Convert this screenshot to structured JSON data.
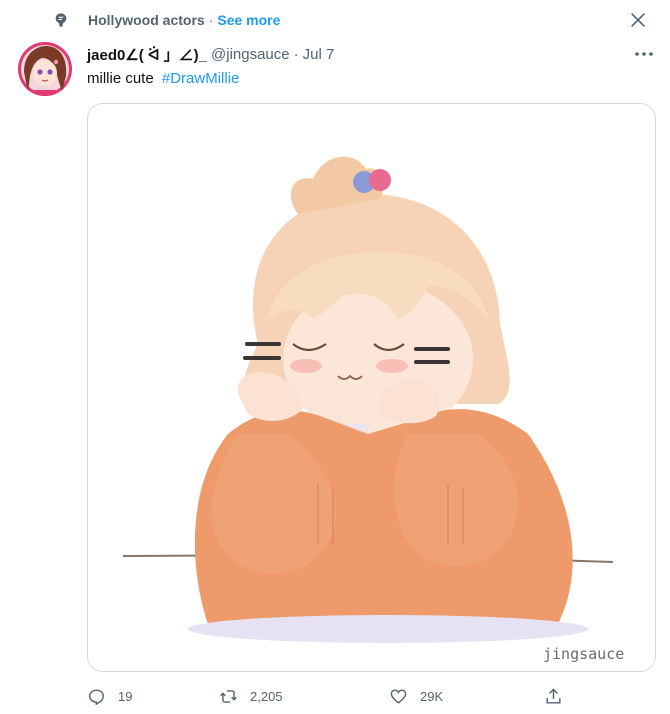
{
  "context": {
    "topic": "Hollywood actors",
    "separator": "·",
    "see_more": "See more"
  },
  "tweet": {
    "author_name": "jaed0∠( ᐛ 」∠)_",
    "handle": "@jingsauce",
    "separator": "·",
    "date": "Jul 7",
    "text": "millie cute",
    "hashtag": "#DrawMillie",
    "image_signature": "jingsauce"
  },
  "actions": {
    "replies": "19",
    "retweets": "2,205",
    "likes": "29K"
  },
  "colors": {
    "accent": "#1d9bf0",
    "muted": "#536471",
    "border": "#cfd9de"
  },
  "icons": [
    "topic-icon",
    "close-icon",
    "more-icon",
    "reply-icon",
    "retweet-icon",
    "like-icon",
    "share-icon"
  ]
}
